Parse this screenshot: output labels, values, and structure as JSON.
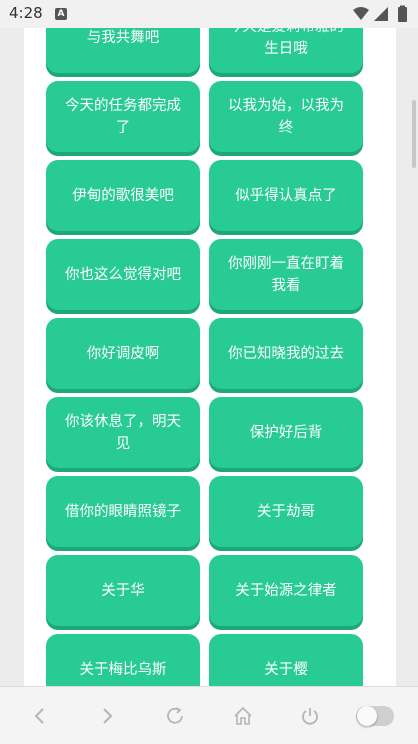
{
  "status_bar": {
    "time": "4:28",
    "badge": "A",
    "icons": [
      "wifi-icon",
      "signal-icon",
      "battery-icon"
    ]
  },
  "topics": [
    {
      "label": "与我共舞吧"
    },
    {
      "label": "今天是爱莉希雅的生日哦"
    },
    {
      "label": "今天的任务都完成了"
    },
    {
      "label": "以我为始，以我为终"
    },
    {
      "label": "伊甸的歌很美吧"
    },
    {
      "label": "似乎得认真点了"
    },
    {
      "label": "你也这么觉得对吧"
    },
    {
      "label": "你刚刚一直在盯着我看"
    },
    {
      "label": "你好调皮啊"
    },
    {
      "label": "你已知晓我的过去"
    },
    {
      "label": "你该休息了，明天见"
    },
    {
      "label": "保护好后背"
    },
    {
      "label": "借你的眼睛照镜子"
    },
    {
      "label": "关于劫哥"
    },
    {
      "label": "关于华"
    },
    {
      "label": "关于始源之律者"
    },
    {
      "label": "关于梅比乌斯"
    },
    {
      "label": "关于樱"
    }
  ],
  "bottom_nav": {
    "icons": [
      "back-icon",
      "forward-icon",
      "refresh-icon",
      "home-icon",
      "power-icon",
      "toggle-switch"
    ]
  },
  "colors": {
    "button": "#27cb93",
    "button_shadow": "#1ea779",
    "button_text": "#ffffff"
  }
}
